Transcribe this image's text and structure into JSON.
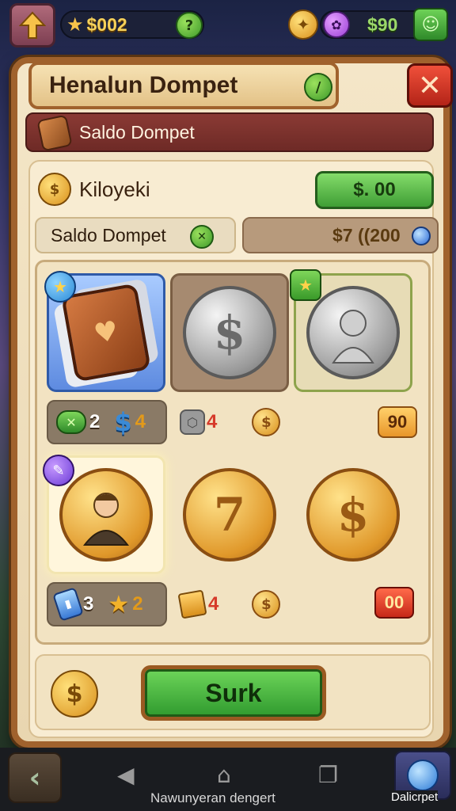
{
  "hud": {
    "currency_left": "$002",
    "badge_left": "?",
    "currency_right": "$90",
    "badge_right_icon": "☺"
  },
  "panel": {
    "title": "Henalun Dompet",
    "title_badge": "/",
    "close_label": "✕",
    "subtitle": "Saldo Dompet"
  },
  "info": {
    "row1_label": "Kiloyeki",
    "row1_button": "$. 00",
    "row2_label": "Saldo Dompet",
    "row2_badge": "✕",
    "row2_value": "$7 ((200"
  },
  "items": {
    "slot_silver_symbol": "$",
    "slot_gold_mid_symbol": "7",
    "slot_gold_right_symbol": "$",
    "row1_stats": {
      "chip_a_num": "2",
      "chip_b_num": "4",
      "chip_c_num": "4",
      "price": "90"
    },
    "row2_stats": {
      "chip_a_num": "3",
      "chip_b_num": "2",
      "chip_c_num": "4",
      "price": "00"
    }
  },
  "action": {
    "button_label": "Surk",
    "coin_symbol": "$"
  },
  "nav": {
    "caption": "Nawunyeran dengert",
    "right_caption": "Dalicrpet"
  },
  "colors": {
    "panel_border": "#a0622d",
    "accent_green": "#3f9e35",
    "close_red": "#c62818",
    "gold": "#e0982a"
  }
}
